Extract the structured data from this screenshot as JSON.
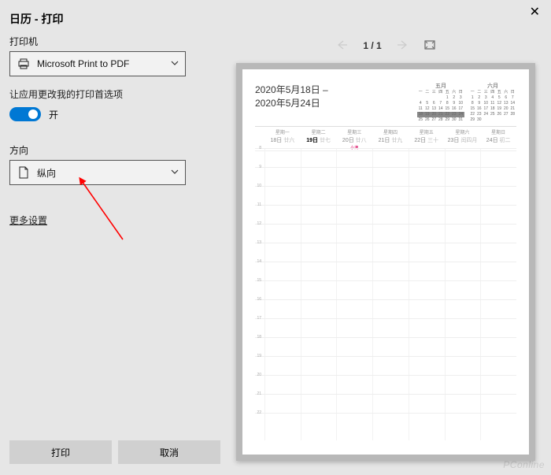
{
  "header": {
    "title": "日历 - 打印"
  },
  "printer": {
    "label": "打印机",
    "selected": "Microsoft Print to PDF"
  },
  "prefs": {
    "line": "让应用更改我的打印首选项",
    "toggle_label": "开",
    "toggle_on": true
  },
  "orientation": {
    "label": "方向",
    "selected": "纵向"
  },
  "more": "更多设置",
  "buttons": {
    "print": "打印",
    "cancel": "取消"
  },
  "pager": {
    "current": 1,
    "total": 1,
    "text": "1 / 1"
  },
  "preview": {
    "range_line1": "2020年5月18日 –",
    "range_line2": "2020年5月24日",
    "mini_months": [
      {
        "title": "五月",
        "dow": [
          "一",
          "二",
          "三",
          "四",
          "五",
          "六",
          "日"
        ]
      },
      {
        "title": "六月",
        "dow": [
          "一",
          "二",
          "三",
          "四",
          "五",
          "六",
          "日"
        ]
      }
    ],
    "week": {
      "days": [
        {
          "wd": "星期一",
          "num": "18日",
          "sub": "廿六",
          "today": false,
          "event": ""
        },
        {
          "wd": "星期二",
          "num": "19日",
          "sub": "廿七",
          "today": true,
          "event": ""
        },
        {
          "wd": "星期三",
          "num": "20日",
          "sub": "廿八",
          "today": false,
          "event": "小满"
        },
        {
          "wd": "星期四",
          "num": "21日",
          "sub": "廿九",
          "today": false,
          "event": ""
        },
        {
          "wd": "星期五",
          "num": "22日",
          "sub": "三十",
          "today": false,
          "event": ""
        },
        {
          "wd": "星期六",
          "num": "23日",
          "sub": "闰四月",
          "today": false,
          "event": ""
        },
        {
          "wd": "星期日",
          "num": "24日",
          "sub": "初二",
          "today": false,
          "event": ""
        }
      ]
    },
    "hours": [
      "8",
      "9",
      "10",
      "11",
      "12",
      "13",
      "14",
      "15",
      "16",
      "17",
      "18",
      "19",
      "20",
      "21",
      "22"
    ]
  },
  "watermark": "PConline"
}
